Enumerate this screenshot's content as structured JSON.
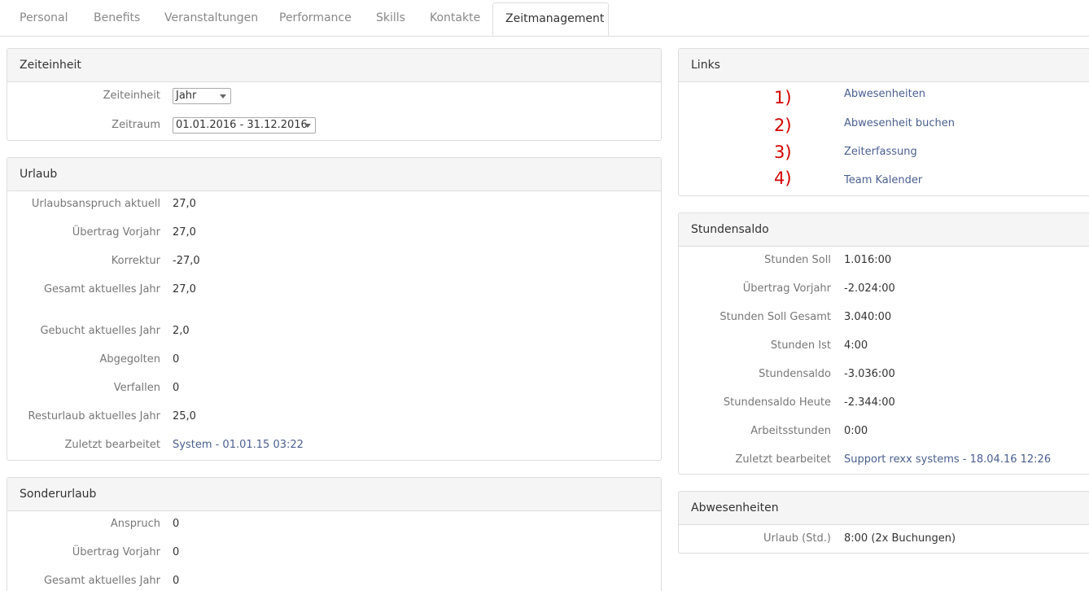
{
  "tabs": [
    "Personal",
    "Benefits",
    "Veranstaltungen",
    "Performance",
    "Skills",
    "Kontakte",
    "Zeitmanagement"
  ],
  "zeiteinheit_panel": {
    "title": "Zeiteinheit",
    "unit_label": "Zeiteinheit",
    "unit_value": "Jahr",
    "range_label": "Zeitraum",
    "range_value": "01.01.2016 - 31.12.2016"
  },
  "urlaub": {
    "title": "Urlaub",
    "rows": [
      {
        "label": "Urlaubsanspruch aktuell",
        "value": "27,0"
      },
      {
        "label": "Übertrag Vorjahr",
        "value": "27,0"
      },
      {
        "label": "Korrektur",
        "value": "-27,0"
      },
      {
        "label": "Gesamt aktuelles Jahr",
        "value": "27,0"
      },
      {
        "label": "Gebucht aktuelles Jahr",
        "value": "2,0"
      },
      {
        "label": "Abgegolten",
        "value": "0"
      },
      {
        "label": "Verfallen",
        "value": "0"
      },
      {
        "label": "Resturlaub aktuelles Jahr",
        "value": "25,0"
      },
      {
        "label": "Zuletzt bearbeitet",
        "value": "System - 01.01.15 03:22"
      }
    ]
  },
  "sonderurlaub": {
    "title": "Sonderurlaub",
    "rows": [
      {
        "label": "Anspruch",
        "value": "0"
      },
      {
        "label": "Übertrag Vorjahr",
        "value": "0"
      },
      {
        "label": "Gesamt aktuelles Jahr",
        "value": "0"
      }
    ]
  },
  "links": {
    "title": "Links",
    "items": [
      {
        "num": "1)",
        "label": "Abwesenheiten"
      },
      {
        "num": "2)",
        "label": "Abwesenheit buchen"
      },
      {
        "num": "3)",
        "label": "Zeiterfassung"
      },
      {
        "num": "4)",
        "label": "Team Kalender"
      }
    ]
  },
  "stundensaldo": {
    "title": "Stundensaldo",
    "rows": [
      {
        "label": "Stunden Soll",
        "value": "1.016:00"
      },
      {
        "label": "Übertrag Vorjahr",
        "value": "-2.024:00"
      },
      {
        "label": "Stunden Soll Gesamt",
        "value": "3.040:00"
      },
      {
        "label": "Stunden Ist",
        "value": "4:00"
      },
      {
        "label": "Stundensaldo",
        "value": "-3.036:00"
      },
      {
        "label": "Stundensaldo Heute",
        "value": "-2.344:00"
      },
      {
        "label": "Arbeitsstunden",
        "value": "0:00"
      },
      {
        "label": "Zuletzt bearbeitet",
        "value": "Support rexx systems - 18.04.16 12:26"
      }
    ]
  },
  "abwesenheiten": {
    "title": "Abwesenheiten",
    "rows": [
      {
        "label": "Urlaub (Std.)",
        "value": "8:00 (2x Buchungen)"
      }
    ]
  },
  "colors": {
    "accent_link": "#4a5f8f",
    "annotation_red": "#d40000",
    "panel_header_bg": "#f5f5f5",
    "border": "#dddddd"
  }
}
